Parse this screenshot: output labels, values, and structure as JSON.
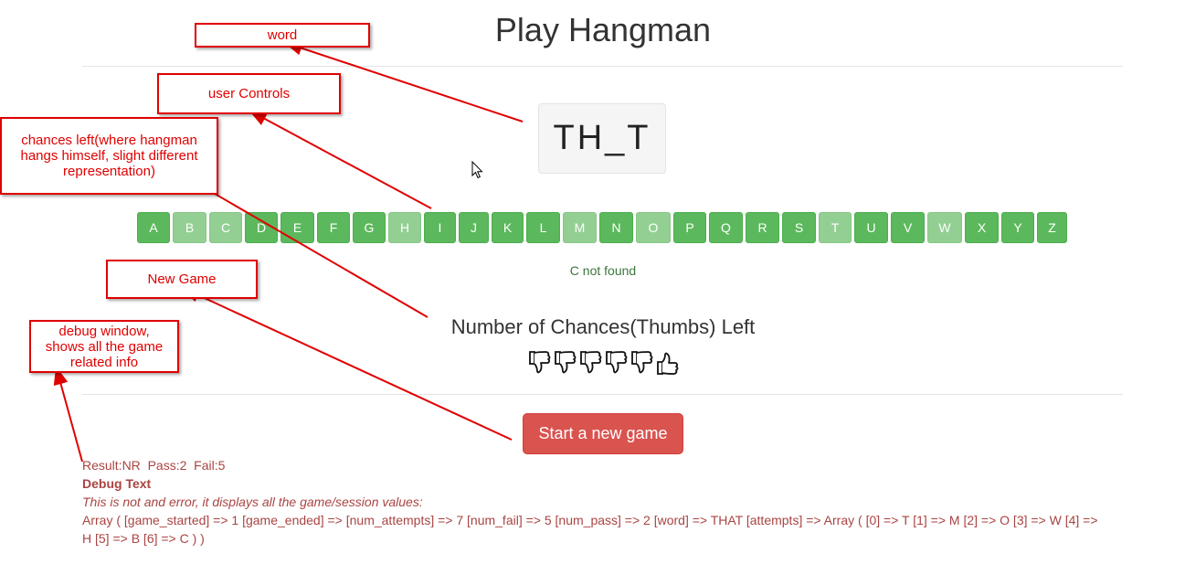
{
  "title": "Play Hangman",
  "word_display": "TH_T",
  "letters": [
    {
      "label": "A",
      "used": false
    },
    {
      "label": "B",
      "used": true
    },
    {
      "label": "C",
      "used": true
    },
    {
      "label": "D",
      "used": false
    },
    {
      "label": "E",
      "used": false
    },
    {
      "label": "F",
      "used": false
    },
    {
      "label": "G",
      "used": false
    },
    {
      "label": "H",
      "used": true
    },
    {
      "label": "I",
      "used": false
    },
    {
      "label": "J",
      "used": false
    },
    {
      "label": "K",
      "used": false
    },
    {
      "label": "L",
      "used": false
    },
    {
      "label": "M",
      "used": true
    },
    {
      "label": "N",
      "used": false
    },
    {
      "label": "O",
      "used": true
    },
    {
      "label": "P",
      "used": false
    },
    {
      "label": "Q",
      "used": false
    },
    {
      "label": "R",
      "used": false
    },
    {
      "label": "S",
      "used": false
    },
    {
      "label": "T",
      "used": true
    },
    {
      "label": "U",
      "used": false
    },
    {
      "label": "V",
      "used": false
    },
    {
      "label": "W",
      "used": true
    },
    {
      "label": "X",
      "used": false
    },
    {
      "label": "Y",
      "used": false
    },
    {
      "label": "Z",
      "used": false
    }
  ],
  "status_message": "C not found",
  "chances_title": "Number of Chances(Thumbs) Left",
  "thumbs": [
    "down",
    "down",
    "down",
    "down",
    "down",
    "up"
  ],
  "new_game_label": "Start a new game",
  "debug": {
    "summary": "Result:NR  Pass:2  Fail:5",
    "heading": "Debug Text",
    "note": "This is not and error, it displays all the game/session values:",
    "line1": "Array ( [game_started] => 1 [game_ended] => [num_attempts] => 7 [num_fail] => 5 [num_pass] => 2 [word] => THAT [attempts] => Array ( [0] => T [1] => M [2] => O [3] => W [4] =>",
    "line2": "H [5] => B [6] => C ) )"
  },
  "annotations": {
    "word": "word",
    "user_controls": "user Controls",
    "chances_left": "chances left(where hangman hangs himself, slight different representation)",
    "new_game": "New Game",
    "debug_window": "debug window, shows all the game related info"
  },
  "colors": {
    "letter_active": "#5cb85c",
    "letter_used": "#93cf93",
    "new_game_button": "#d9534f",
    "debug_text": "#a94442",
    "status_text": "#3c763d",
    "annotation_red": "#e00000"
  }
}
